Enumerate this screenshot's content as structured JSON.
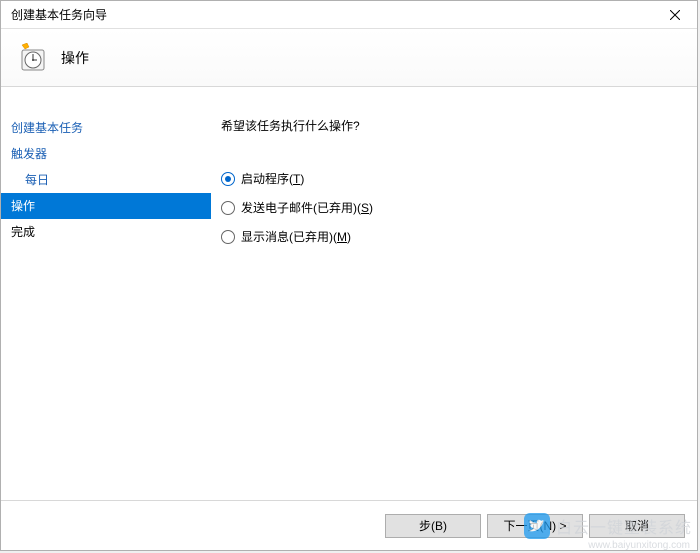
{
  "titlebar": {
    "title": "创建基本任务向导"
  },
  "header": {
    "title": "操作"
  },
  "sidebar": {
    "items": [
      {
        "label": "创建基本任务",
        "indent": false
      },
      {
        "label": "触发器",
        "indent": false
      },
      {
        "label": "每日",
        "indent": true
      },
      {
        "label": "操作",
        "indent": false,
        "selected": true
      },
      {
        "label": "完成",
        "indent": false
      }
    ]
  },
  "content": {
    "prompt": "希望该任务执行什么操作?",
    "options": [
      {
        "label": "启动程序",
        "hotkey": "T",
        "checked": true
      },
      {
        "label": "发送电子邮件(已弃用)",
        "hotkey": "S",
        "checked": false
      },
      {
        "label": "显示消息(已弃用)",
        "hotkey": "M",
        "checked": false
      }
    ]
  },
  "footer": {
    "back": "步(B)",
    "next": "下一页(N) >",
    "cancel": "取消"
  },
  "watermark": {
    "text": "白云一键重装系统",
    "url": "www.baiyunxitong.com"
  }
}
